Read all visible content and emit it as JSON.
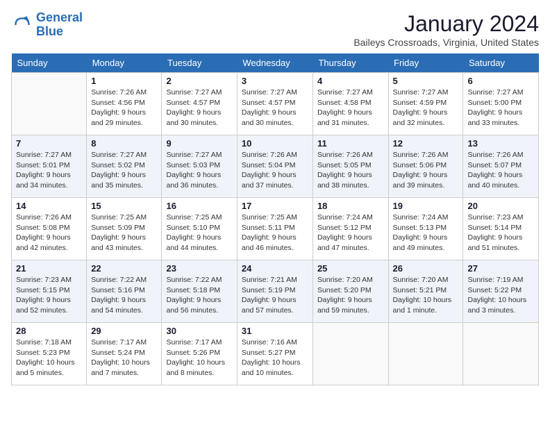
{
  "app": {
    "name": "GeneralBlue",
    "logo_line1": "General",
    "logo_line2": "Blue"
  },
  "calendar": {
    "month": "January 2024",
    "location": "Baileys Crossroads, Virginia, United States",
    "days_of_week": [
      "Sunday",
      "Monday",
      "Tuesday",
      "Wednesday",
      "Thursday",
      "Friday",
      "Saturday"
    ],
    "weeks": [
      [
        {
          "day": "",
          "content": ""
        },
        {
          "day": "1",
          "content": "Sunrise: 7:26 AM\nSunset: 4:56 PM\nDaylight: 9 hours\nand 29 minutes."
        },
        {
          "day": "2",
          "content": "Sunrise: 7:27 AM\nSunset: 4:57 PM\nDaylight: 9 hours\nand 30 minutes."
        },
        {
          "day": "3",
          "content": "Sunrise: 7:27 AM\nSunset: 4:57 PM\nDaylight: 9 hours\nand 30 minutes."
        },
        {
          "day": "4",
          "content": "Sunrise: 7:27 AM\nSunset: 4:58 PM\nDaylight: 9 hours\nand 31 minutes."
        },
        {
          "day": "5",
          "content": "Sunrise: 7:27 AM\nSunset: 4:59 PM\nDaylight: 9 hours\nand 32 minutes."
        },
        {
          "day": "6",
          "content": "Sunrise: 7:27 AM\nSunset: 5:00 PM\nDaylight: 9 hours\nand 33 minutes."
        }
      ],
      [
        {
          "day": "7",
          "content": "Sunrise: 7:27 AM\nSunset: 5:01 PM\nDaylight: 9 hours\nand 34 minutes."
        },
        {
          "day": "8",
          "content": "Sunrise: 7:27 AM\nSunset: 5:02 PM\nDaylight: 9 hours\nand 35 minutes."
        },
        {
          "day": "9",
          "content": "Sunrise: 7:27 AM\nSunset: 5:03 PM\nDaylight: 9 hours\nand 36 minutes."
        },
        {
          "day": "10",
          "content": "Sunrise: 7:26 AM\nSunset: 5:04 PM\nDaylight: 9 hours\nand 37 minutes."
        },
        {
          "day": "11",
          "content": "Sunrise: 7:26 AM\nSunset: 5:05 PM\nDaylight: 9 hours\nand 38 minutes."
        },
        {
          "day": "12",
          "content": "Sunrise: 7:26 AM\nSunset: 5:06 PM\nDaylight: 9 hours\nand 39 minutes."
        },
        {
          "day": "13",
          "content": "Sunrise: 7:26 AM\nSunset: 5:07 PM\nDaylight: 9 hours\nand 40 minutes."
        }
      ],
      [
        {
          "day": "14",
          "content": "Sunrise: 7:26 AM\nSunset: 5:08 PM\nDaylight: 9 hours\nand 42 minutes."
        },
        {
          "day": "15",
          "content": "Sunrise: 7:25 AM\nSunset: 5:09 PM\nDaylight: 9 hours\nand 43 minutes."
        },
        {
          "day": "16",
          "content": "Sunrise: 7:25 AM\nSunset: 5:10 PM\nDaylight: 9 hours\nand 44 minutes."
        },
        {
          "day": "17",
          "content": "Sunrise: 7:25 AM\nSunset: 5:11 PM\nDaylight: 9 hours\nand 46 minutes."
        },
        {
          "day": "18",
          "content": "Sunrise: 7:24 AM\nSunset: 5:12 PM\nDaylight: 9 hours\nand 47 minutes."
        },
        {
          "day": "19",
          "content": "Sunrise: 7:24 AM\nSunset: 5:13 PM\nDaylight: 9 hours\nand 49 minutes."
        },
        {
          "day": "20",
          "content": "Sunrise: 7:23 AM\nSunset: 5:14 PM\nDaylight: 9 hours\nand 51 minutes."
        }
      ],
      [
        {
          "day": "21",
          "content": "Sunrise: 7:23 AM\nSunset: 5:15 PM\nDaylight: 9 hours\nand 52 minutes."
        },
        {
          "day": "22",
          "content": "Sunrise: 7:22 AM\nSunset: 5:16 PM\nDaylight: 9 hours\nand 54 minutes."
        },
        {
          "day": "23",
          "content": "Sunrise: 7:22 AM\nSunset: 5:18 PM\nDaylight: 9 hours\nand 56 minutes."
        },
        {
          "day": "24",
          "content": "Sunrise: 7:21 AM\nSunset: 5:19 PM\nDaylight: 9 hours\nand 57 minutes."
        },
        {
          "day": "25",
          "content": "Sunrise: 7:20 AM\nSunset: 5:20 PM\nDaylight: 9 hours\nand 59 minutes."
        },
        {
          "day": "26",
          "content": "Sunrise: 7:20 AM\nSunset: 5:21 PM\nDaylight: 10 hours\nand 1 minute."
        },
        {
          "day": "27",
          "content": "Sunrise: 7:19 AM\nSunset: 5:22 PM\nDaylight: 10 hours\nand 3 minutes."
        }
      ],
      [
        {
          "day": "28",
          "content": "Sunrise: 7:18 AM\nSunset: 5:23 PM\nDaylight: 10 hours\nand 5 minutes."
        },
        {
          "day": "29",
          "content": "Sunrise: 7:17 AM\nSunset: 5:24 PM\nDaylight: 10 hours\nand 7 minutes."
        },
        {
          "day": "30",
          "content": "Sunrise: 7:17 AM\nSunset: 5:26 PM\nDaylight: 10 hours\nand 8 minutes."
        },
        {
          "day": "31",
          "content": "Sunrise: 7:16 AM\nSunset: 5:27 PM\nDaylight: 10 hours\nand 10 minutes."
        },
        {
          "day": "",
          "content": ""
        },
        {
          "day": "",
          "content": ""
        },
        {
          "day": "",
          "content": ""
        }
      ]
    ]
  }
}
